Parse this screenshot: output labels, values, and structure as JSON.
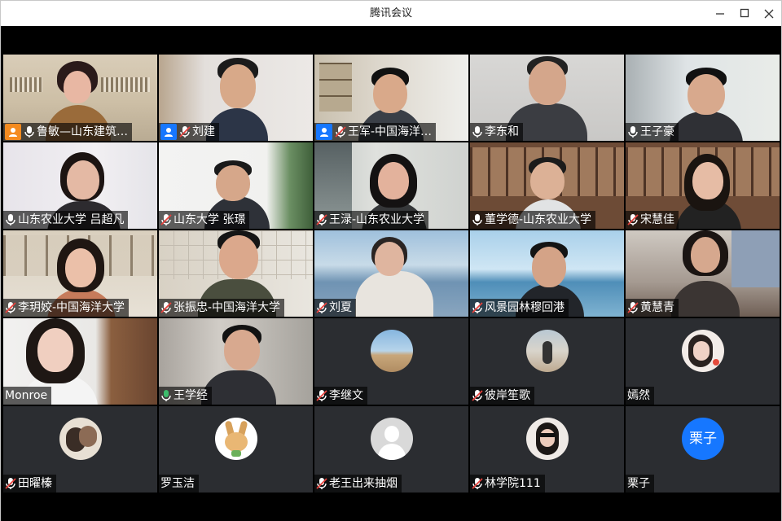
{
  "window": {
    "title": "腾讯会议"
  },
  "participants": [
    {
      "name": "鲁敏—山东建筑…",
      "mic": "on",
      "host": "orange"
    },
    {
      "name": "刘建",
      "mic": "muted",
      "host": "blue"
    },
    {
      "name": "王军-中国海洋…",
      "mic": "muted",
      "host": "blue"
    },
    {
      "name": "李东和",
      "mic": "on",
      "host": ""
    },
    {
      "name": "王子豪",
      "mic": "on",
      "host": ""
    },
    {
      "name": "山东农业大学 吕超凡",
      "mic": "on",
      "host": ""
    },
    {
      "name": "山东大学  张璟",
      "mic": "muted",
      "host": ""
    },
    {
      "name": "王渌-山东农业大学",
      "mic": "muted",
      "host": ""
    },
    {
      "name": "董学德-山东农业大学",
      "mic": "on",
      "host": ""
    },
    {
      "name": "宋慧佳",
      "mic": "muted",
      "host": ""
    },
    {
      "name": "李玥姣-中国海洋大学",
      "mic": "muted",
      "host": ""
    },
    {
      "name": "张振忠-中国海洋大学",
      "mic": "muted",
      "host": ""
    },
    {
      "name": "刘夏",
      "mic": "muted",
      "host": ""
    },
    {
      "name": "风景园林穆回港",
      "mic": "muted",
      "host": ""
    },
    {
      "name": "黄慧青",
      "mic": "muted",
      "host": ""
    },
    {
      "name": "Monroe",
      "mic": "none",
      "host": ""
    },
    {
      "name": "王学经",
      "mic": "on-green",
      "host": ""
    },
    {
      "name": "李继文",
      "mic": "muted",
      "host": ""
    },
    {
      "name": "彼岸笙歌",
      "mic": "muted",
      "host": ""
    },
    {
      "name": "嫣然",
      "mic": "none",
      "host": ""
    },
    {
      "name": "田曜榛",
      "mic": "muted",
      "host": ""
    },
    {
      "name": "罗玉洁",
      "mic": "none",
      "host": ""
    },
    {
      "name": "老王出来抽烟",
      "mic": "muted",
      "host": ""
    },
    {
      "name": "林学院111",
      "mic": "muted",
      "host": ""
    },
    {
      "name": "栗子",
      "mic": "none",
      "host": ""
    }
  ],
  "avatar_letter": "栗子",
  "colors": {
    "accent": "#1677ff",
    "active_border": "#3dbd6c",
    "muted_red": "#e5413c",
    "mic_green": "#3dbd6c"
  }
}
